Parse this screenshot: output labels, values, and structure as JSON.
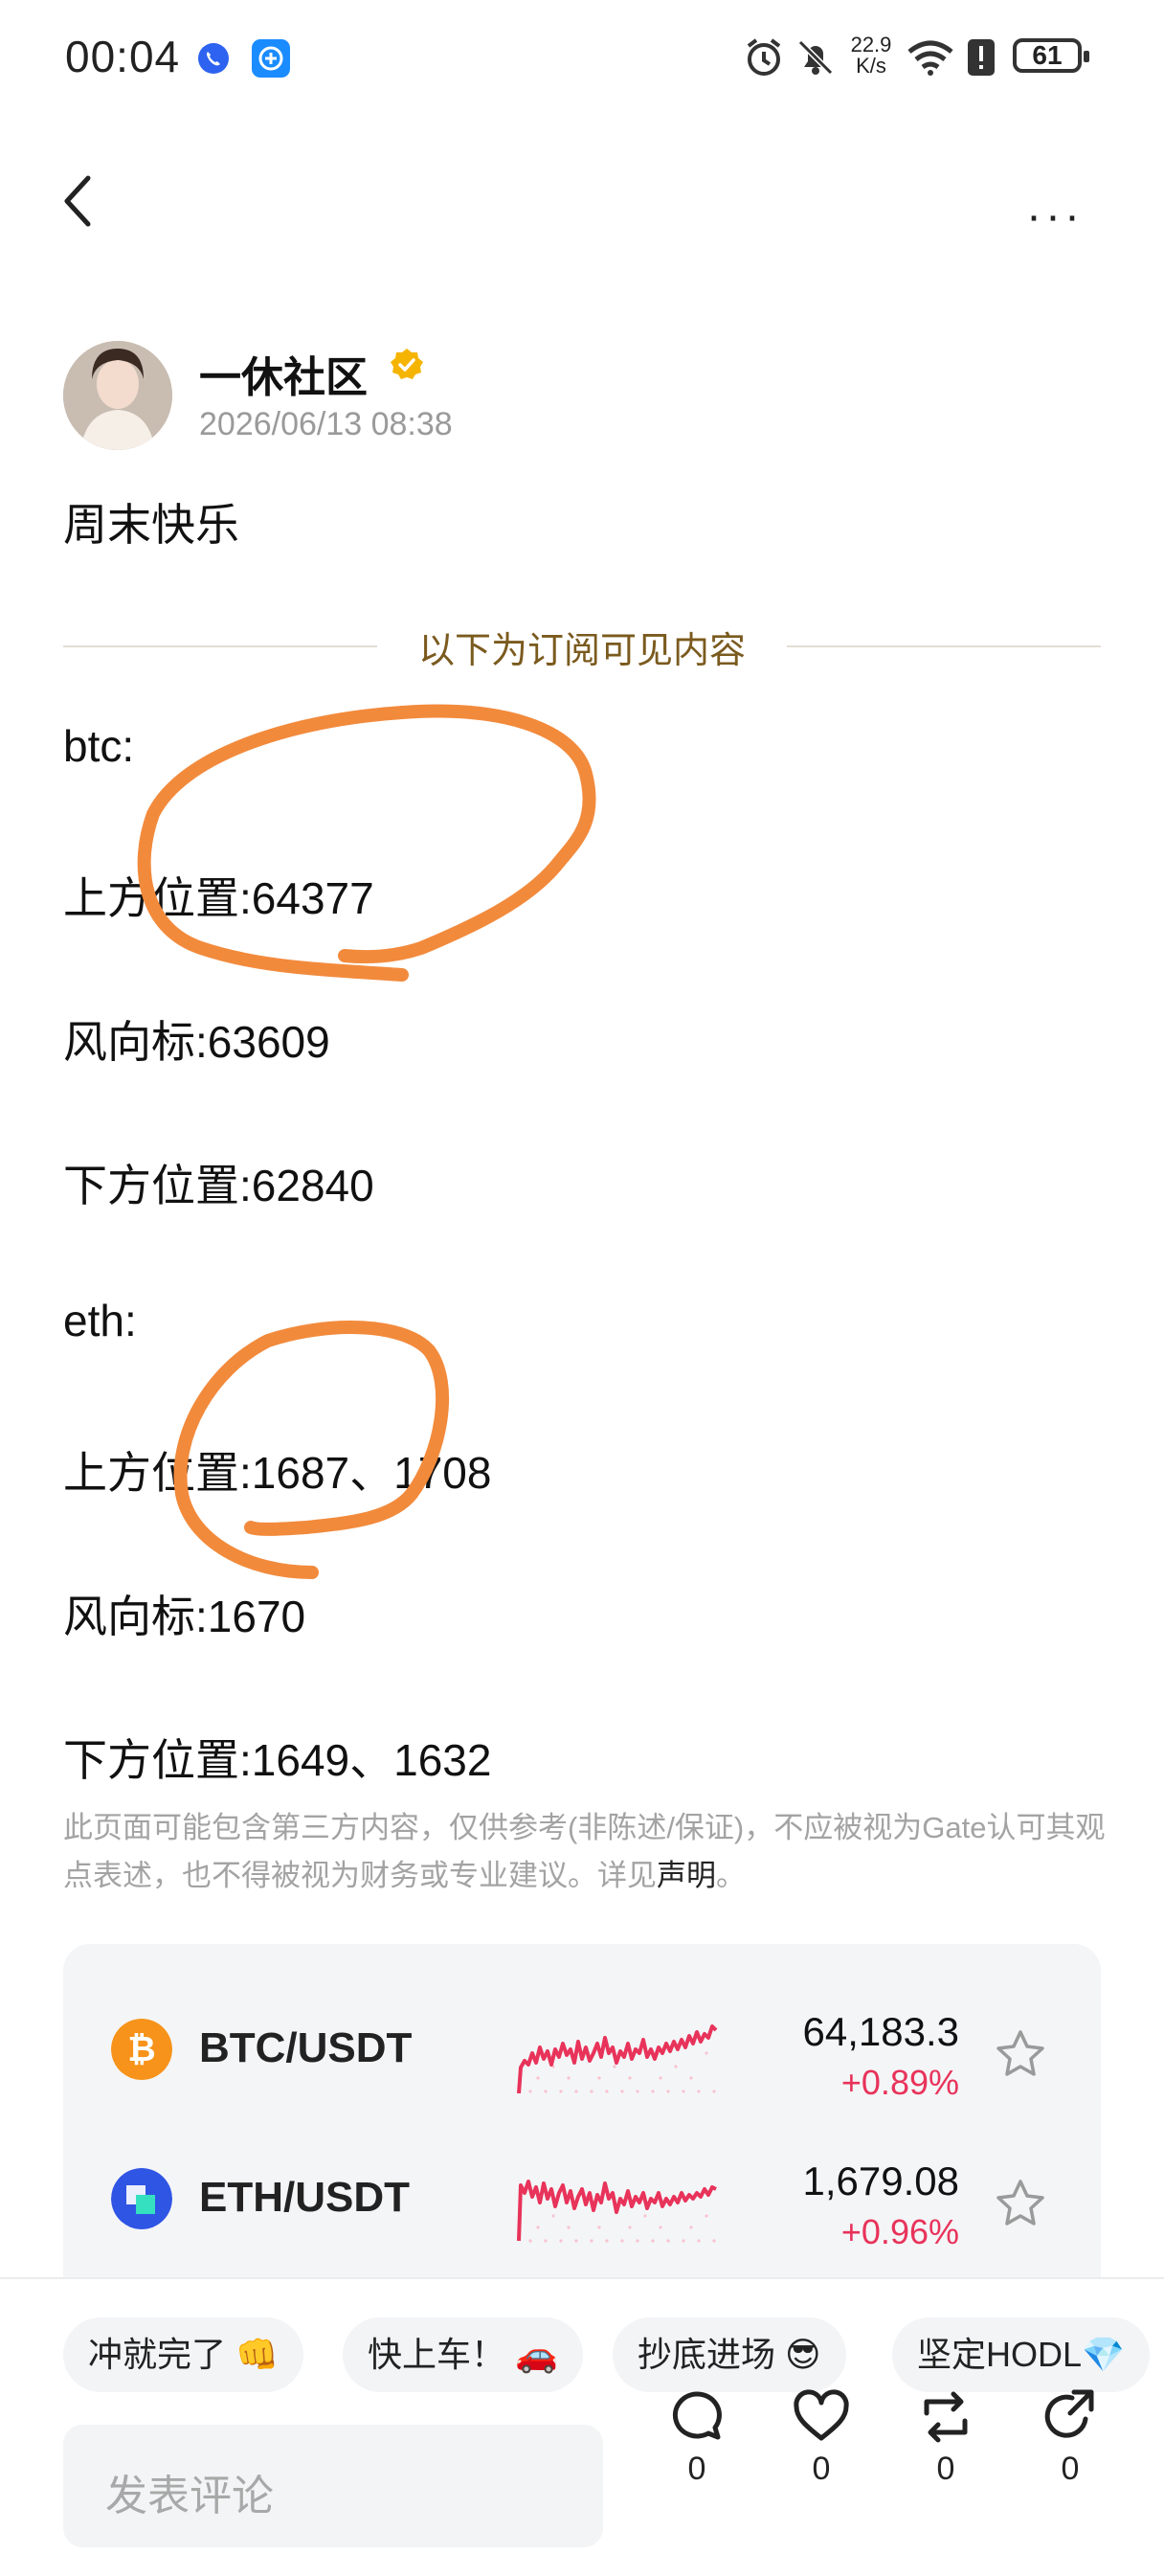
{
  "status_bar": {
    "time": "00:04",
    "net_speed_value": "22.9",
    "net_speed_unit": "K/s",
    "battery": "61",
    "icons": [
      "phone-call-icon",
      "app-notify-icon",
      "alarm-icon",
      "mute-icon",
      "wifi-icon",
      "alert-icon",
      "battery-icon"
    ]
  },
  "header": {
    "back_icon": "back-arrow-icon",
    "more_label": "···"
  },
  "author": {
    "name": "一休社区",
    "time": "2026/06/13 08:38",
    "verified_icon": "verified-badge-icon"
  },
  "post": {
    "title": "周末快乐",
    "divider": "以下为订阅可见内容",
    "lines": [
      "btc:",
      "上方位置:64377",
      "风向标:63609",
      "下方位置:62840",
      "eth:",
      "上方位置:1687、1708",
      "风向标:1670",
      "下方位置:1649、1632"
    ],
    "annotation_color": "#f28a3c"
  },
  "disclaimer": {
    "text": "此页面可能包含第三方内容，仅供参考(非陈述/保证)，不应被视为Gate认可其观点表述，也不得被视为财务或专业建议。详见",
    "link": "声明",
    "end": "。"
  },
  "market": [
    {
      "pair": "BTC/USDT",
      "price": "64,183.3",
      "change": "+0.89%",
      "icon_color": "#f7931a",
      "icon": "bitcoin-icon"
    },
    {
      "pair": "ETH/USDT",
      "price": "1,679.08",
      "change": "+0.96%",
      "icon_color": "#2f55e4",
      "icon": "eth-icon"
    }
  ],
  "quick_replies": [
    "冲就完了 👊",
    "快上车！ 🚗",
    "抄底进场 😎",
    "坚定HODL💎"
  ],
  "comment": {
    "placeholder": "发表评论"
  },
  "actions": [
    {
      "name": "comment",
      "count": "0"
    },
    {
      "name": "like",
      "count": "0"
    },
    {
      "name": "repost",
      "count": "0"
    },
    {
      "name": "share",
      "count": "0"
    }
  ],
  "colors": {
    "accent_text": "#7a5a1e",
    "positive": "#e8335a",
    "sparkline": "#e8335a"
  }
}
